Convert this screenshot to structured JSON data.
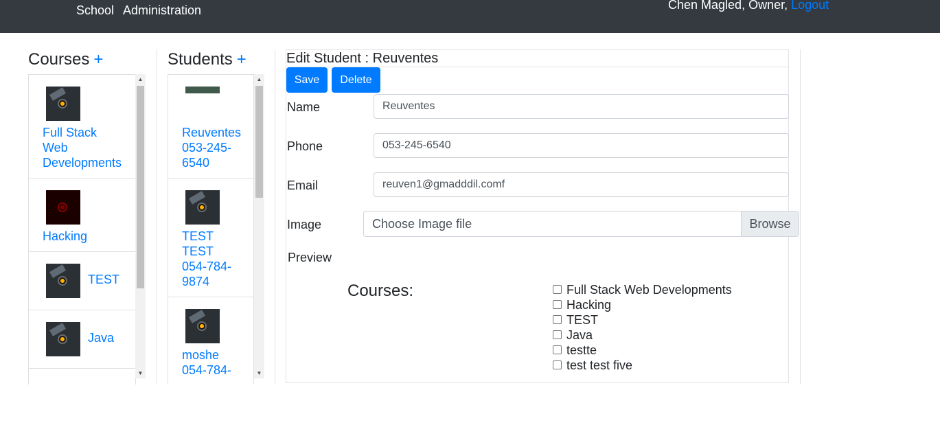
{
  "nav": {
    "school": "School",
    "administration": "Administration"
  },
  "user": {
    "name_role": "Chen Magled, Owner,",
    "logout": "Logout"
  },
  "courses_panel": {
    "title": "Courses",
    "add": "+",
    "items": [
      {
        "label_lines": [
          "Full Stack",
          "Web",
          "Developments"
        ]
      },
      {
        "label_lines": [
          "Hacking"
        ]
      },
      {
        "label_lines": [
          "TEST"
        ]
      },
      {
        "label_lines": [
          "Java"
        ]
      }
    ]
  },
  "students_panel": {
    "title": "Students",
    "add": "+",
    "items": [
      {
        "label_lines": [
          "Reuventes",
          "053-245-",
          "6540"
        ]
      },
      {
        "label_lines": [
          "TEST",
          "TEST",
          "054-784-",
          "9874"
        ]
      },
      {
        "label_lines": [
          "moshe",
          "054-784-"
        ]
      }
    ]
  },
  "edit": {
    "title": "Edit Student : Reuventes",
    "save": "Save",
    "delete": "Delete",
    "name_label": "Name",
    "name_value": "Reuventes",
    "phone_label": "Phone",
    "phone_value": "053-245-6540",
    "email_label": "Email",
    "email_value": "reuven1@gmadddil.comf",
    "image_label": "Image",
    "image_placeholder": "Choose Image file",
    "browse": "Browse",
    "preview_label": "Preview",
    "courses_label": "Courses:",
    "course_options": [
      "Full Stack Web Developments",
      "Hacking",
      "TEST",
      "Java",
      "testte",
      "test test five"
    ]
  },
  "colors": {
    "navbar": "#343a40",
    "primary": "#007bff"
  }
}
